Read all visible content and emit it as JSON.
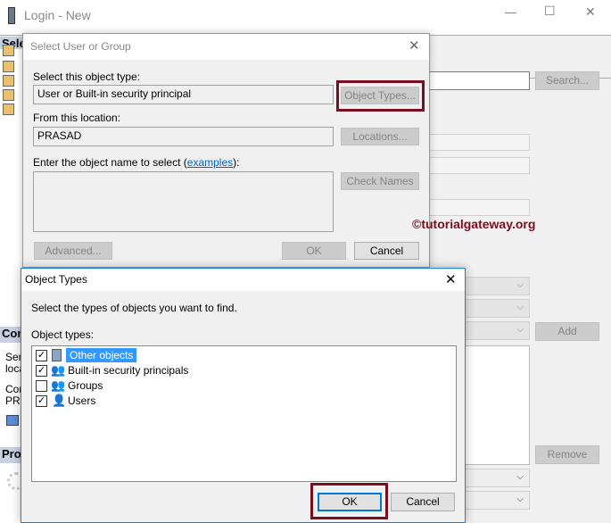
{
  "main_window": {
    "title": "Login - New",
    "minimize": "—",
    "maximize": "☐",
    "close": "✕",
    "sidebar": {
      "header1": "Sele",
      "items_partial": [
        "",
        "",
        "",
        "",
        ""
      ],
      "header2": "Con",
      "server_partial": "Ser",
      "loca_partial": "loca",
      "conn_partial": "Con",
      "pr_partial": "PR",
      "header3": "Prog"
    },
    "search_label": "Search...",
    "add_label": "Add",
    "remove_label": "Remove"
  },
  "select_dialog": {
    "title": "Select User or Group",
    "object_type_label": "Select this object type:",
    "object_type_value": "User or Built-in security principal",
    "object_types_button": "Object Types...",
    "location_label": "From this location:",
    "location_value": "PRASAD",
    "locations_button": "Locations...",
    "enter_label": "Enter the object name to select (",
    "examples_link": "examples",
    "enter_label_end": "):",
    "check_names_button": "Check Names",
    "advanced_button": "Advanced...",
    "ok_button": "OK",
    "cancel_button": "Cancel"
  },
  "watermark": "©tutorialgateway.org",
  "object_types_dialog": {
    "title": "Object Types",
    "instruction": "Select the types of objects you want to find.",
    "list_label": "Object types:",
    "items": [
      {
        "label": "Other objects",
        "checked": true,
        "selected": true
      },
      {
        "label": "Built-in security principals",
        "checked": true
      },
      {
        "label": "Groups",
        "checked": false
      },
      {
        "label": "Users",
        "checked": true
      }
    ],
    "ok_button": "OK",
    "cancel_button": "Cancel"
  },
  "colors": {
    "highlight": "#3399ff",
    "annotation": "#7b0d1e",
    "link": "#0066cc"
  }
}
